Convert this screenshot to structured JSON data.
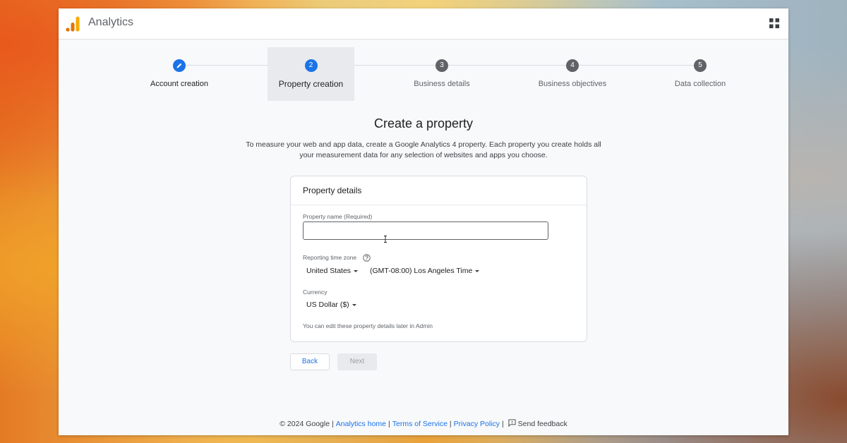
{
  "header": {
    "app_title": "Analytics",
    "logo_icon": "analytics-bars-logo",
    "apps_icon": "apps-grid-icon"
  },
  "stepper": {
    "steps": [
      {
        "number": "1",
        "label": "Account creation",
        "state": "completed",
        "icon": "pencil-icon"
      },
      {
        "number": "2",
        "label": "Property creation",
        "state": "current"
      },
      {
        "number": "3",
        "label": "Business details",
        "state": "upcoming"
      },
      {
        "number": "4",
        "label": "Business objectives",
        "state": "upcoming"
      },
      {
        "number": "5",
        "label": "Data collection",
        "state": "upcoming"
      }
    ]
  },
  "main": {
    "title": "Create a property",
    "description": "To measure your web and app data, create a Google Analytics 4 property. Each property you create holds all your measurement data for any selection of websites and apps you choose."
  },
  "card": {
    "title": "Property details",
    "property_name_label": "Property name (Required)",
    "property_name_value": "",
    "timezone_label": "Reporting time zone",
    "country_value": "United States",
    "timezone_value": "(GMT-08:00) Los Angeles Time",
    "currency_label": "Currency",
    "currency_value": "US Dollar ($)",
    "hint": "You can edit these property details later in Admin"
  },
  "actions": {
    "back_label": "Back",
    "next_label": "Next"
  },
  "footer": {
    "copyright": "© 2024 Google",
    "analytics_home": "Analytics home",
    "terms": "Terms of Service",
    "privacy": "Privacy Policy",
    "feedback": "Send feedback",
    "separator": "|"
  },
  "colors": {
    "accent_blue": "#1a73e8",
    "step_gray": "#5f6368",
    "logo_orange": "#f9ab00",
    "logo_dark_orange": "#e37400"
  }
}
